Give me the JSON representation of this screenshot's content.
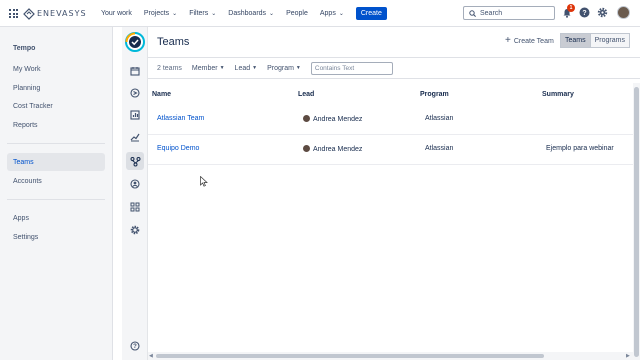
{
  "topbar": {
    "logo_text": "ENEVASYS",
    "nav": [
      {
        "label": "Your work",
        "has_chevron": false
      },
      {
        "label": "Projects",
        "has_chevron": true
      },
      {
        "label": "Filters",
        "has_chevron": true
      },
      {
        "label": "Dashboards",
        "has_chevron": true
      },
      {
        "label": "People",
        "has_chevron": false
      },
      {
        "label": "Apps",
        "has_chevron": true
      }
    ],
    "create_label": "Create",
    "search_placeholder": "Search",
    "notification_count": "1",
    "icons": [
      "app-grid-icon",
      "bell-icon",
      "help-icon",
      "settings-icon"
    ]
  },
  "sidebar": {
    "title": "Tempo",
    "items": [
      {
        "label": "My Work"
      },
      {
        "label": "Planning"
      },
      {
        "label": "Cost Tracker"
      },
      {
        "label": "Reports"
      },
      {
        "label": "Teams",
        "active": true
      },
      {
        "label": "Accounts"
      },
      {
        "label": "Apps"
      },
      {
        "label": "Settings"
      }
    ]
  },
  "rail": {
    "icons": [
      "tempo-logo-icon",
      "calendar-icon",
      "planning-icon",
      "chart-bar-icon",
      "trend-icon",
      "teams-icon",
      "account-icon",
      "apps-icon",
      "settings-icon",
      "help-icon"
    ]
  },
  "main": {
    "title": "Teams",
    "create_team_label": "Create Team",
    "toggle": {
      "teams": "Teams",
      "programs": "Programs",
      "active": "teams"
    },
    "filters": {
      "count": "2 teams",
      "member": "Member",
      "lead": "Lead",
      "program": "Program",
      "text_placeholder": "Contains Text"
    },
    "table": {
      "headers": {
        "name": "Name",
        "lead": "Lead",
        "program": "Program",
        "summary": "Summary"
      },
      "rows": [
        {
          "name": "Atlassian Team",
          "lead": "Andrea Mendez",
          "program": "Atlassian",
          "summary": ""
        },
        {
          "name": "Equipo Demo",
          "lead": "Andrea Mendez",
          "program": "Atlassian",
          "summary": "Ejemplo para webinar"
        }
      ]
    }
  },
  "colors": {
    "accent": "#0052cc",
    "link": "#0052cc",
    "active_item": "#e4e6ea",
    "badge": "#de350b"
  }
}
